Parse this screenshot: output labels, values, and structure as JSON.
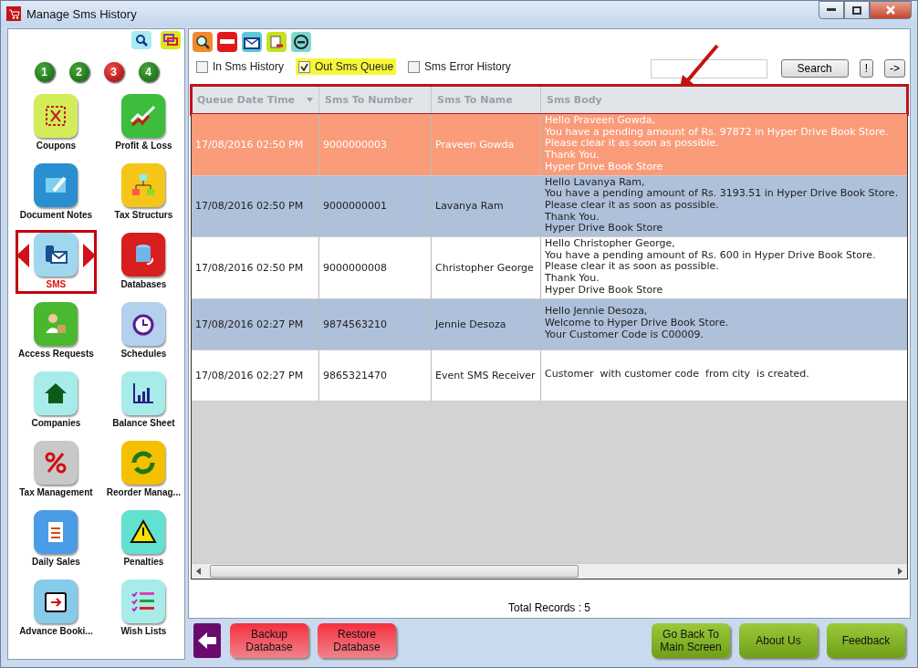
{
  "window": {
    "title": "Manage Sms History"
  },
  "steps": [
    {
      "label": "1",
      "selected": false
    },
    {
      "label": "2",
      "selected": false
    },
    {
      "label": "3",
      "selected": true
    },
    {
      "label": "4",
      "selected": false
    }
  ],
  "sidebar": {
    "items": [
      {
        "label": "Coupons",
        "kind": "coupon",
        "selected": false
      },
      {
        "label": "Profit & Loss",
        "kind": "profit",
        "selected": false
      },
      {
        "label": "Document Notes",
        "kind": "notes",
        "selected": false
      },
      {
        "label": "Tax Structurs",
        "kind": "structure",
        "selected": false
      },
      {
        "label": "SMS",
        "kind": "sms",
        "selected": true
      },
      {
        "label": "Databases",
        "kind": "database",
        "selected": false
      },
      {
        "label": "Access Requests",
        "kind": "access",
        "selected": false
      },
      {
        "label": "Schedules",
        "kind": "clock",
        "selected": false
      },
      {
        "label": "Companies",
        "kind": "house",
        "selected": false
      },
      {
        "label": "Balance Sheet",
        "kind": "chart",
        "selected": false
      },
      {
        "label": "Tax Management",
        "kind": "percent",
        "selected": false
      },
      {
        "label": "Reorder Manag...",
        "kind": "reorder",
        "selected": false
      },
      {
        "label": "Daily Sales",
        "kind": "doc",
        "selected": false
      },
      {
        "label": "Penalties",
        "kind": "warning",
        "selected": false
      },
      {
        "label": "Advance Booki...",
        "kind": "calendar",
        "selected": false
      },
      {
        "label": "Wish Lists",
        "kind": "list",
        "selected": false
      }
    ]
  },
  "filters": [
    {
      "label": "In Sms History",
      "checked": false
    },
    {
      "label": "Out Sms Queue",
      "checked": true
    },
    {
      "label": "Sms Error History",
      "checked": false
    }
  ],
  "search": {
    "button": "Search",
    "extra_buttons": [
      "!",
      "->"
    ]
  },
  "table": {
    "columns": [
      "Queue Date Time",
      "Sms To Number",
      "Sms To Name",
      "Sms Body"
    ],
    "rows": [
      {
        "selected": true,
        "cells": [
          "17/08/2016 02:50 PM",
          "9000000003",
          "Praveen Gowda"
        ],
        "body": [
          "Hello Praveen Gowda,",
          "You have a pending amount of Rs. 97872 in Hyper Drive Book Store.",
          "Please clear it as soon as possible.",
          "Thank You.",
          "Hyper Drive Book Store"
        ]
      },
      {
        "selected": false,
        "cells": [
          "17/08/2016 02:50 PM",
          "9000000001",
          "Lavanya Ram"
        ],
        "body": [
          "Hello Lavanya Ram,",
          "You have a pending amount of Rs. 3193.51 in Hyper Drive Book Store.",
          "Please clear it as soon as possible.",
          "Thank You.",
          "Hyper Drive Book Store"
        ]
      },
      {
        "selected": false,
        "cells": [
          "17/08/2016 02:50 PM",
          "9000000008",
          "Christopher George"
        ],
        "body": [
          "Hello Christopher George,",
          "You have a pending amount of Rs. 600 in Hyper Drive Book Store.",
          "Please clear it as soon as possible.",
          "Thank You.",
          "Hyper Drive Book Store"
        ]
      },
      {
        "selected": false,
        "cells": [
          "17/08/2016 02:27 PM",
          "9874563210",
          "Jennie Desoza"
        ],
        "body": [
          "Hello Jennie Desoza,",
          "Welcome to Hyper Drive Book Store.",
          "Your Customer Code is C00009."
        ]
      },
      {
        "selected": false,
        "cells": [
          "17/08/2016 02:27 PM",
          "9865321470",
          "Event SMS Receiver"
        ],
        "body": [
          "Customer  with customer code  from city  is created."
        ]
      }
    ]
  },
  "total_records": "Total Records : 5",
  "footer": {
    "left": [
      {
        "label": "Backup Database"
      },
      {
        "label": "Restore Database"
      }
    ],
    "right": [
      {
        "label": "Go Back To Main Screen"
      },
      {
        "label": "About Us"
      },
      {
        "label": "Feedback"
      }
    ]
  }
}
